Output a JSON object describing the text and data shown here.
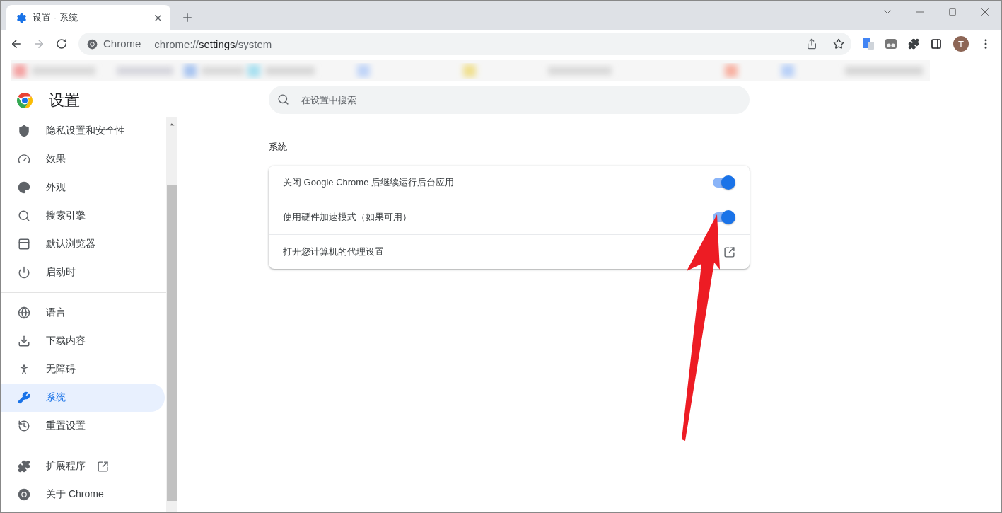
{
  "tab": {
    "title": "设置 - 系统",
    "selected": true
  },
  "address": {
    "site": "Chrome",
    "url": "chrome://**settings**/system"
  },
  "profile": {
    "initial": "T"
  },
  "sidebar": {
    "title": "设置",
    "groups": [
      [
        {
          "label": "隐私设置和安全性",
          "selected": false
        },
        {
          "label": "效果",
          "selected": false
        },
        {
          "label": "外观",
          "selected": false
        },
        {
          "label": "搜索引擎",
          "selected": false
        },
        {
          "label": "默认浏览器",
          "selected": false
        },
        {
          "label": "启动时",
          "selected": false
        }
      ],
      [
        {
          "label": "语言",
          "selected": false
        },
        {
          "label": "下载内容",
          "selected": false
        },
        {
          "label": "无障碍",
          "selected": false
        },
        {
          "label": "系统",
          "selected": true
        },
        {
          "label": "重置设置",
          "selected": false
        }
      ],
      [
        {
          "label": "扩展程序",
          "selected": false,
          "external": true
        },
        {
          "label": "关于 Chrome",
          "selected": false
        }
      ]
    ]
  },
  "search": {
    "placeholder": "在设置中搜索"
  },
  "section": {
    "title": "系统",
    "rows": [
      {
        "kind": "toggle",
        "label": "关闭 Google Chrome 后继续运行后台应用",
        "on": true
      },
      {
        "kind": "toggle",
        "label": "使用硬件加速模式（如果可用）",
        "on": true
      },
      {
        "kind": "link",
        "label": "打开您计算机的代理设置"
      }
    ]
  }
}
